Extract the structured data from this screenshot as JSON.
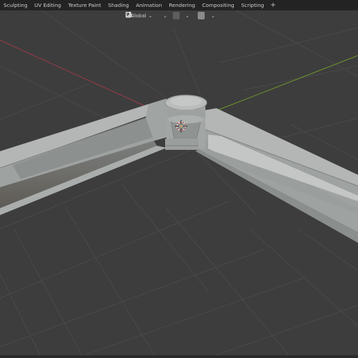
{
  "workspace_tabs": [
    "Sculpting",
    "UV Editing",
    "Texture Paint",
    "Shading",
    "Animation",
    "Rendering",
    "Compositing",
    "Scripting"
  ],
  "add_tab_label": "+",
  "header": {
    "orientation_value": "Global",
    "orientation_icon": "transform-orientation-icon",
    "pivot_icon": "pivot-link-icon",
    "snap_icon": "magnet-snap-icon",
    "snap_target_icon": "snap-increment-icon",
    "proportional_icon": "proportional-edit-icon",
    "falloff_icon": "falloff-curve-icon",
    "dropdown_glyph": "⌄"
  },
  "viewport": {
    "background": "#3d3d3d",
    "grid_color": "#4a4a4a",
    "x_axis_color": "#9a3b48",
    "y_axis_color": "#6e9a2c",
    "object_color": "#a4a8a6",
    "origin_icon": "object-origin-icon"
  }
}
